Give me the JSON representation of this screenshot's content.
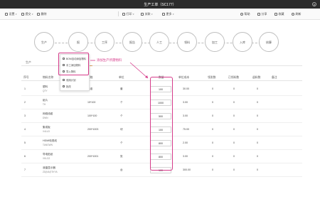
{
  "window": {
    "title": "生产工单（SC177）",
    "close_icon": "✕"
  },
  "toolbar": {
    "items": [
      {
        "label": "设置",
        "icon": "settings-icon",
        "caret": "▾"
      },
      {
        "label": "提交",
        "icon": "submit-icon",
        "caret": "▾"
      },
      {
        "label": "删除",
        "icon": "delete-icon"
      },
      {
        "label": "打印",
        "icon": "print-icon",
        "caret": "▾"
      },
      {
        "label": "关联",
        "icon": "link-icon",
        "caret": "▾"
      },
      {
        "label": "更多",
        "icon": "more-icon",
        "caret": "▾"
      },
      {
        "label": "帮助",
        "icon": "help-icon"
      },
      {
        "label": "分享",
        "icon": "share-icon"
      },
      {
        "label": "收藏",
        "icon": "favorite-icon"
      },
      {
        "label": "刷新",
        "icon": "refresh-icon"
      }
    ]
  },
  "flow_steps": [
    "生产",
    "报",
    "工序",
    "报告",
    "人工",
    "领料",
    "加工",
    "入库",
    "核算"
  ],
  "tabs": [
    {
      "label": "生产",
      "active": false
    },
    {
      "label": "物料",
      "active": true
    }
  ],
  "dropdown": {
    "items": [
      {
        "label": "BOM自动添加物料",
        "icon": "bom-icon"
      },
      {
        "label": "手工添加物料",
        "icon": "manual-add-icon"
      },
      {
        "label": "导入物料",
        "icon": "import-icon"
      },
      {
        "label": "领用计划",
        "icon": "plan-icon"
      },
      {
        "label": "批改",
        "icon": "batch-edit-icon"
      }
    ]
  },
  "annotation": {
    "text": "添加生产所需物料",
    "color": "#d63b8a"
  },
  "table": {
    "headers": [
      "序号",
      "物料名称",
      "规格",
      "单位",
      "数量",
      "单位成本",
      "领发数",
      "已领料数",
      "退料数",
      "备注"
    ],
    "rows": [
      {
        "no": "1",
        "name": "塑料",
        "sub": "QTY",
        "spec": "标准",
        "unit": "套",
        "qty": "100",
        "cost": "30.00",
        "issue": "0",
        "received": "0",
        "returned": "0"
      },
      {
        "no": "2",
        "name": "纸片",
        "sub": "TH",
        "spec": "15*100",
        "unit": "个",
        "qty": "1000",
        "cost": "3.00",
        "issue": "0",
        "received": "0",
        "returned": "0"
      },
      {
        "no": "3",
        "name": "网络线缆",
        "sub": "DWN",
        "spec": "100*100",
        "unit": "个",
        "qty": "500",
        "cost": "3.00",
        "issue": "0",
        "received": "0",
        "returned": "0"
      },
      {
        "no": "4",
        "name": "集成板",
        "sub": "V4LU3",
        "spec": "200*1003",
        "unit": "块",
        "qty": "100",
        "cost": "75.00",
        "issue": "0",
        "received": "0",
        "returned": "0"
      },
      {
        "no": "5",
        "name": "HDMI电视线",
        "sub": "TANGWN",
        "spec": "",
        "unit": "个",
        "qty": "800",
        "cost": "2.00",
        "issue": "0",
        "received": "0",
        "returned": "0"
      },
      {
        "no": "6",
        "name": "导电贴纸",
        "sub": "VKLG2",
        "spec": "200*1001",
        "unit": "张",
        "qty": "800",
        "cost": "3.00",
        "issue": "0",
        "received": "0",
        "returned": "0"
      },
      {
        "no": "7",
        "name": "液晶显示器",
        "sub": "ZD(NA)T5YYA",
        "spec": "",
        "unit": "台",
        "qty": "100",
        "cost": "300.00",
        "issue": "0",
        "received": "0",
        "returned": "0"
      }
    ]
  }
}
